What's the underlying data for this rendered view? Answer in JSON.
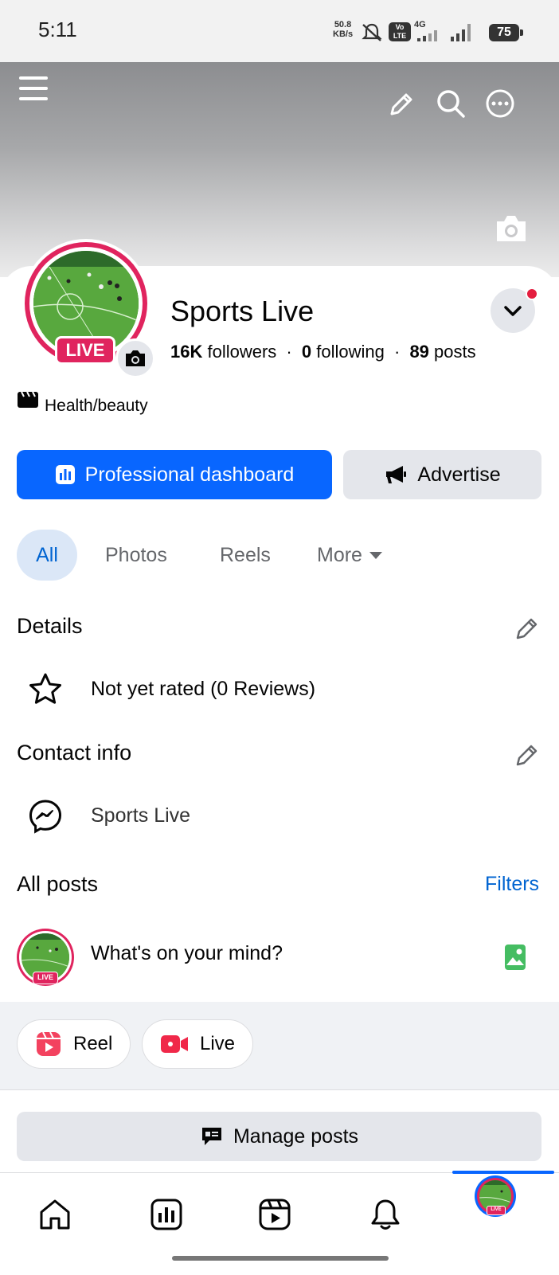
{
  "status_bar": {
    "time": "5:11",
    "net_speed_value": "50.8",
    "net_speed_unit": "KB/s",
    "volte_label": "Vo LTE",
    "network_type": "4G",
    "battery_level": "75"
  },
  "profile": {
    "name": "Sports Live",
    "avatar_badge": "LIVE",
    "followers_count": "16K",
    "followers_label": "followers",
    "following_count": "0",
    "following_label": "following",
    "posts_count": "89",
    "posts_label": "posts",
    "separator": "·",
    "category": "Health/beauty"
  },
  "actions": {
    "professional_dashboard_label": "Professional dashboard",
    "advertise_label": "Advertise"
  },
  "tabs": [
    {
      "label": "All",
      "active": true
    },
    {
      "label": "Photos",
      "active": false
    },
    {
      "label": "Reels",
      "active": false
    },
    {
      "label": "More",
      "active": false
    }
  ],
  "details": {
    "title": "Details",
    "rating_text": "Not yet rated (0 Reviews)"
  },
  "contact": {
    "title": "Contact info",
    "messenger_name": "Sports Live"
  },
  "posts": {
    "title": "All posts",
    "filters_label": "Filters",
    "composer_placeholder": "What's on your mind?",
    "composer_avatar_badge": "LIVE",
    "reel_label": "Reel",
    "live_label": "Live",
    "manage_posts_label": "Manage posts"
  },
  "bottom_nav": {
    "avatar_badge": "LIVE",
    "items": [
      "home",
      "dashboard",
      "video",
      "notifications",
      "profile"
    ],
    "active": "profile"
  },
  "colors": {
    "accent": "#0866ff",
    "link": "#0064d1",
    "live_red": "#e0245e",
    "notification_dot": "#e41e3f",
    "photo_green": "#45bd62"
  }
}
